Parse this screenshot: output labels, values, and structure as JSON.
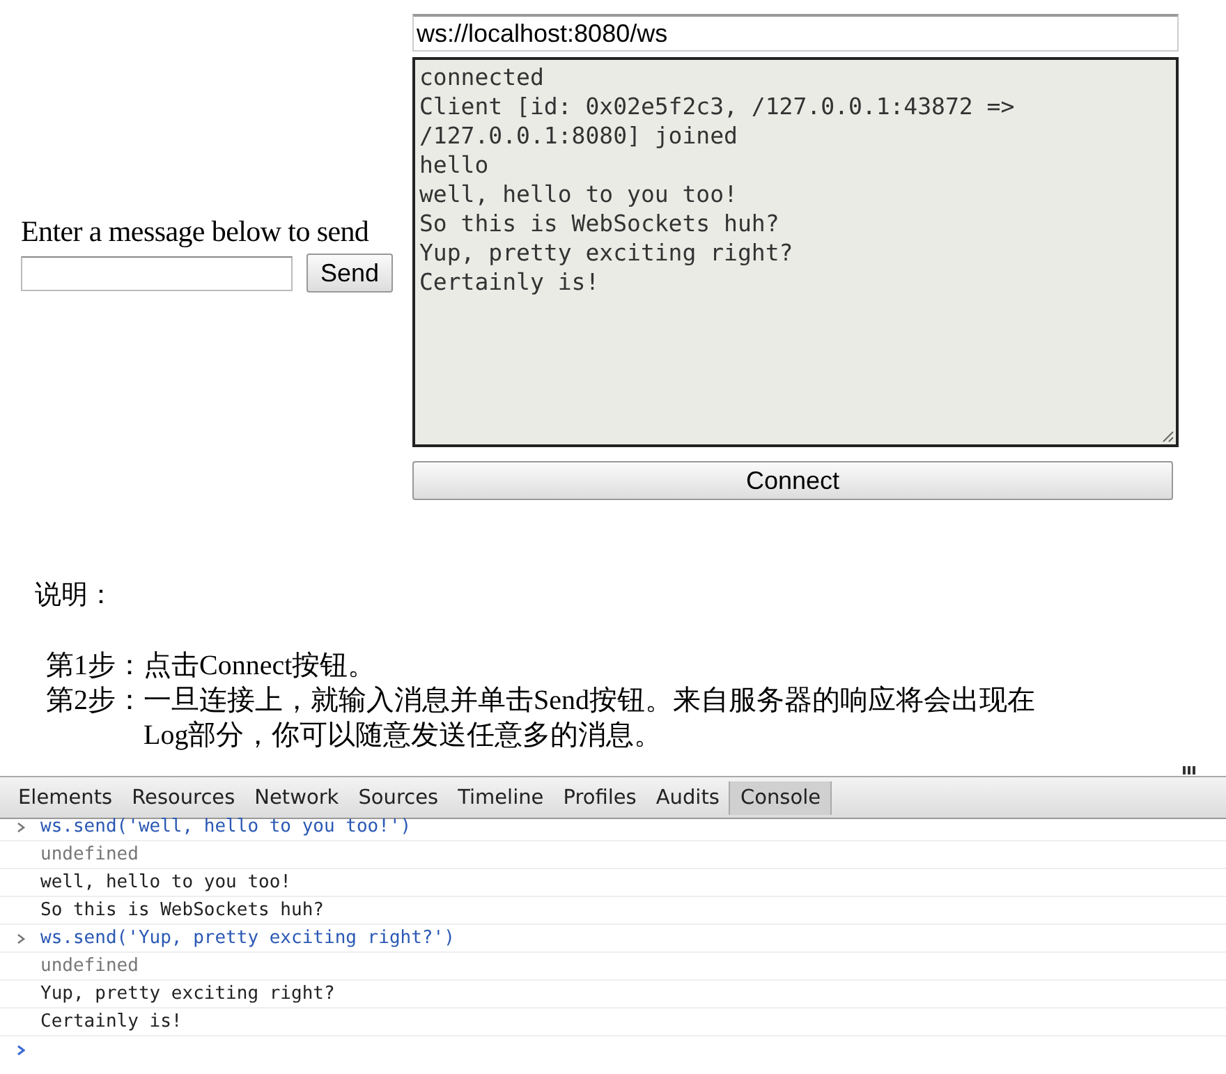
{
  "form": {
    "prompt_label": "Enter a message below to send",
    "send_button": "Send"
  },
  "url_field": {
    "value": "ws://localhost:8080/ws"
  },
  "log": {
    "lines": [
      "connected",
      "Client [id: 0x02e5f2c3, /127.0.0.1:43872 => /127.0.0.1:8080] joined",
      "hello",
      "well, hello to you too!",
      "So this is WebSockets huh?",
      "Yup, pretty exciting right?",
      "Certainly is!"
    ]
  },
  "connect_button": "Connect",
  "notes": {
    "heading": "说明：",
    "steps": [
      {
        "label": "第1步：",
        "text": "点击Connect按钮。"
      },
      {
        "label": "第2步：",
        "text": "一旦连接上，就输入消息并单击Send按钮。来自服务器的响应将会出现在Log部分，你可以随意发送任意多的消息。"
      }
    ]
  },
  "devtools": {
    "tabs": [
      {
        "label": "Elements",
        "selected": false
      },
      {
        "label": "Resources",
        "selected": false
      },
      {
        "label": "Network",
        "selected": false
      },
      {
        "label": "Sources",
        "selected": false
      },
      {
        "label": "Timeline",
        "selected": false
      },
      {
        "label": "Profiles",
        "selected": false
      },
      {
        "label": "Audits",
        "selected": false
      },
      {
        "label": "Console",
        "selected": true
      }
    ],
    "console": [
      {
        "kind": "input",
        "text": "ws.send('well, hello to you too!')"
      },
      {
        "kind": "result",
        "text": "undefined"
      },
      {
        "kind": "log",
        "text": "well, hello to you too!"
      },
      {
        "kind": "log",
        "text": "So this is WebSockets huh?"
      },
      {
        "kind": "input",
        "text": "ws.send('Yup, pretty exciting right?')"
      },
      {
        "kind": "result",
        "text": "undefined"
      },
      {
        "kind": "log",
        "text": "Yup, pretty exciting right?"
      },
      {
        "kind": "log",
        "text": "Certainly is!"
      }
    ]
  }
}
